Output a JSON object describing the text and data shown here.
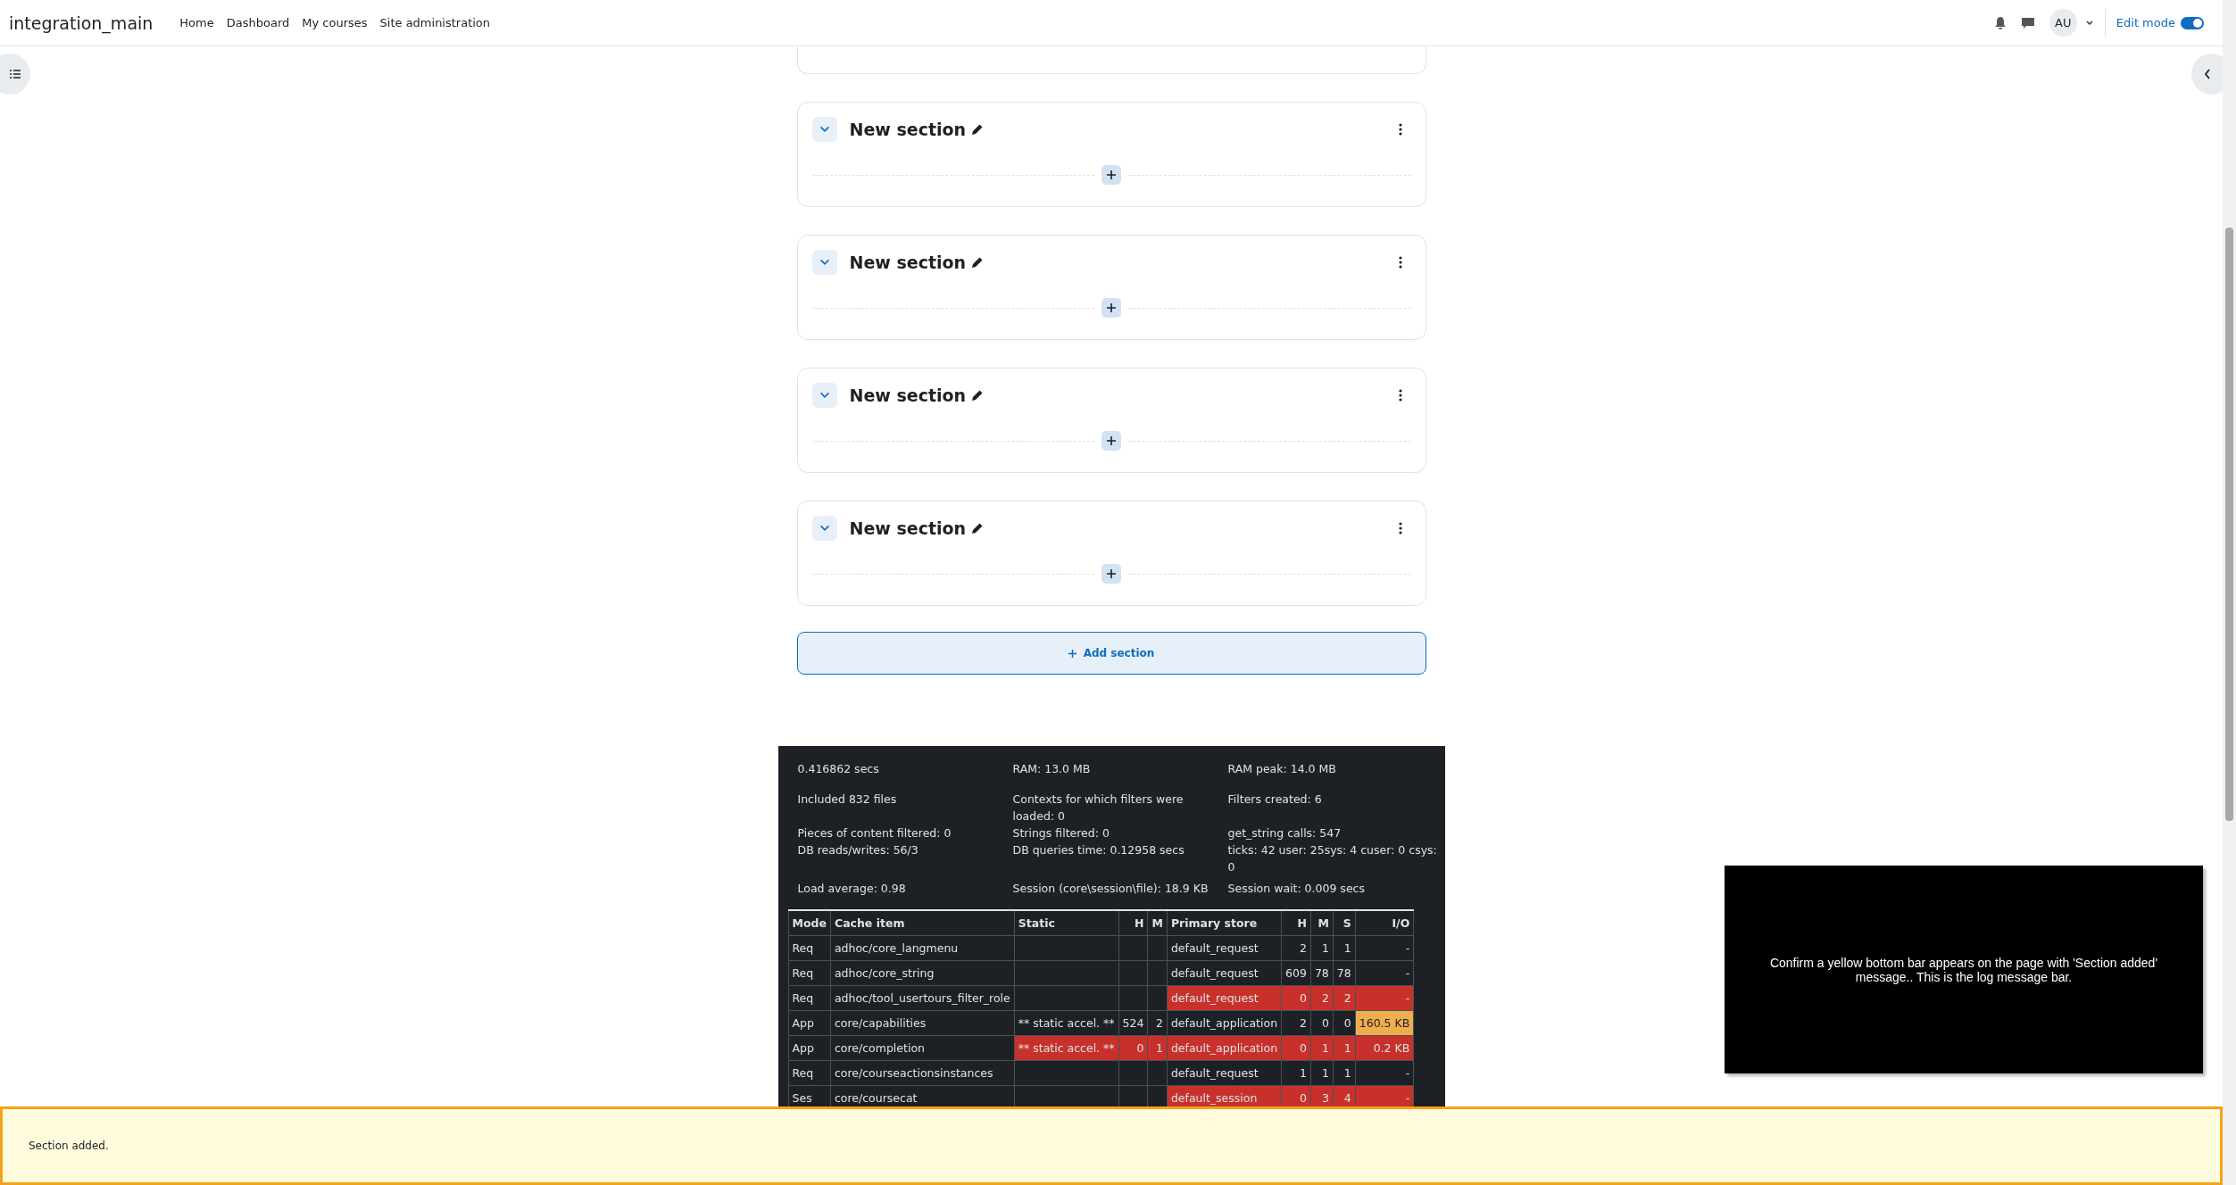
{
  "navbar": {
    "brand": "integration_main",
    "links": [
      "Home",
      "Dashboard",
      "My courses",
      "Site administration"
    ],
    "avatar": "AU",
    "edit_mode": {
      "label": "Edit mode",
      "on": true
    }
  },
  "sections": [
    {
      "title": "New section",
      "expanded": true
    },
    {
      "title": "New section",
      "expanded": true
    },
    {
      "title": "New section",
      "expanded": true
    },
    {
      "title": "New section",
      "expanded": true
    }
  ],
  "add_section": "Add section",
  "performance": {
    "stats": [
      "0.416862 secs",
      "RAM: 13.0 MB",
      "RAM peak: 14.0 MB",
      "Included 832 files",
      "Contexts for which filters were loaded: 0",
      "Filters created: 6",
      "Pieces of content filtered: 0",
      "Strings filtered: 0",
      "get_string calls: 547",
      "DB reads/writes: 56/3",
      "DB queries time: 0.12958 secs",
      "ticks: 42 user: 25sys: 4 cuser: 0 csys: 0",
      "Load average: 0.98",
      "Session (core\\session\\file): 18.9 KB",
      "Session wait: 0.009 secs"
    ],
    "cache_table": {
      "columns": [
        "Mode",
        "Cache item",
        "Static",
        "H",
        "M",
        "Primary store",
        "H",
        "M",
        "S",
        "I/O"
      ],
      "rows": [
        {
          "mode": "Req",
          "item": "adhoc/core_langmenu",
          "store": "default_request",
          "h": "2",
          "m": "1",
          "s": "1",
          "io": "-",
          "static_miss": false,
          "store_miss": false,
          "io_miss": false,
          "io_warning": false
        },
        {
          "mode": "Req",
          "item": "adhoc/core_string",
          "store": "default_request",
          "h": "609",
          "m": "78",
          "s": "78",
          "io": "-",
          "static_miss": false,
          "store_miss": false,
          "io_miss": false,
          "io_warning": false
        },
        {
          "mode": "Req",
          "item": "adhoc/tool_usertours_filter_role",
          "store": "default_request",
          "h": "0",
          "m": "2",
          "s": "2",
          "io": "-",
          "static_miss": false,
          "store_miss": true,
          "io_miss": true,
          "io_warning": false
        },
        {
          "mode": "App",
          "item": "core/capabilities",
          "static": "** static accel. **",
          "static_h": "524",
          "static_m": "2",
          "store": "default_application",
          "h": "2",
          "m": "0",
          "s": "0",
          "io": "160.5 KB",
          "static_miss": false,
          "store_miss": false,
          "io_miss": false,
          "io_warning": true
        },
        {
          "mode": "App",
          "item": "core/completion",
          "static": "** static accel. **",
          "static_h": "0",
          "static_m": "1",
          "store": "default_application",
          "h": "0",
          "m": "1",
          "s": "1",
          "io": "0.2 KB",
          "static_miss": true,
          "store_miss": true,
          "io_miss": true,
          "io_warning": false
        },
        {
          "mode": "Req",
          "item": "core/courseactionsinstances",
          "store": "default_request",
          "h": "1",
          "m": "1",
          "s": "1",
          "io": "-",
          "static_miss": false,
          "store_miss": false,
          "io_miss": false,
          "io_warning": false
        },
        {
          "mode": "Ses",
          "item": "core/coursecat",
          "store": "default_session",
          "h": "0",
          "m": "3",
          "s": "4",
          "io": "-",
          "static_miss": false,
          "store_miss": true,
          "io_miss": true,
          "io_warning": false
        }
      ]
    }
  },
  "test_instruction": "Confirm a yellow bottom bar appears on the page with 'Section added' message.. This is the log message bar.",
  "log_bar": {
    "message": "Section added."
  }
}
